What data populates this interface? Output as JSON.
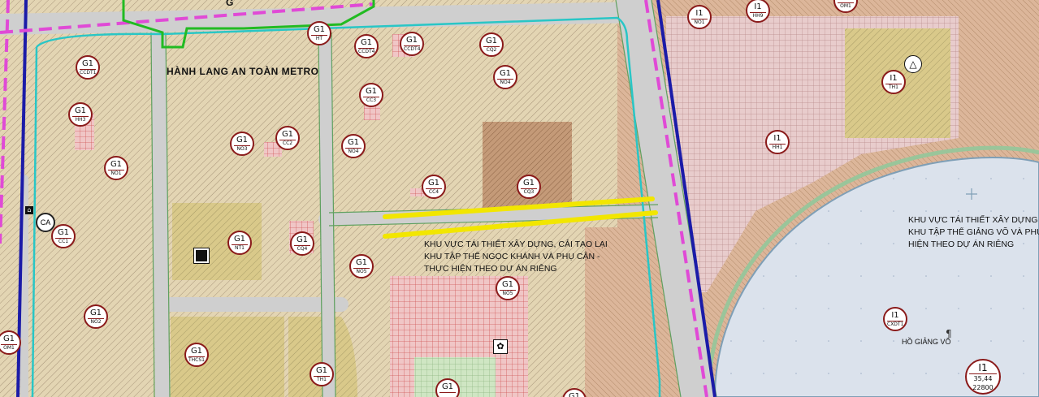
{
  "labels": {
    "metro_corridor": "HÀNH LANG AN TOÀN METRO",
    "notice_ngoc_khanh": [
      "KHU VỰC TÁI THIẾT XÂY DỰNG, CẢI TẠO LẠI",
      "KHU TẬP THỂ  NGỌC KHÁNH VÀ PHỤ CẬN -",
      "THỰC HIỆN THEO DỰ ÁN RIÊNG"
    ],
    "notice_giang_vo": [
      "KHU VỰC TÁI THIẾT XÂY DỰNG",
      "KHU TẬP THỂ GIẢNG VÕ VÀ PHỤ",
      "HIỆN THEO DỰ ÁN RIÊNG"
    ],
    "lake": "HỒ GIẢNG VÕ",
    "ca": "CA",
    "top_fragment": "G"
  },
  "markers": [
    {
      "code": "G1",
      "sub": "HT"
    },
    {
      "code": "G1",
      "sub": "CCDT4"
    },
    {
      "code": "G1",
      "sub": "CCDT4"
    },
    {
      "code": "G1",
      "sub": "CQ2"
    },
    {
      "code": "G1",
      "sub": "CCDT1"
    },
    {
      "code": "G1",
      "sub": "HH3"
    },
    {
      "code": "G1",
      "sub": "CC3"
    },
    {
      "code": "G1",
      "sub": "NO4"
    },
    {
      "code": "G1",
      "sub": "NO3"
    },
    {
      "code": "G1",
      "sub": "CC2"
    },
    {
      "code": "G1",
      "sub": "NO4"
    },
    {
      "code": "G1",
      "sub": "NO1"
    },
    {
      "code": "G1",
      "sub": "CC4"
    },
    {
      "code": "G1",
      "sub": "CQ3"
    },
    {
      "code": "G1",
      "sub": "CC1"
    },
    {
      "code": "G1",
      "sub": "NT1"
    },
    {
      "code": "G1",
      "sub": "CQ4"
    },
    {
      "code": "G1",
      "sub": "NO5"
    },
    {
      "code": "G1",
      "sub": "NO5"
    },
    {
      "code": "G1",
      "sub": "NO2"
    },
    {
      "code": "G1",
      "sub": "OM1"
    },
    {
      "code": "G1",
      "sub": "THCS1"
    },
    {
      "code": "G1",
      "sub": "TH1"
    },
    {
      "code": "G1",
      "sub": ""
    },
    {
      "code": "G1",
      "sub": ""
    },
    {
      "code": "I1",
      "sub": "NO1"
    },
    {
      "code": "I1",
      "sub": "HH9"
    },
    {
      "code": "I1",
      "sub": "OM1"
    },
    {
      "code": "I1",
      "sub": "TH1"
    },
    {
      "code": "I1",
      "sub": "HH1"
    },
    {
      "code": "I1",
      "sub": "CXDT1"
    },
    {
      "code": "I1",
      "sub": "35,44 22800"
    }
  ],
  "colors": {
    "residential": "#e3d5b3",
    "school": "#d9c98a",
    "mixed_use_pink": "#e8cccc",
    "office_brown": "#c49a78",
    "road": "#c9c9c9",
    "lake": "#d8e0ea",
    "metro_line": "#e04ad6",
    "boundary_blue": "#1b1ba8",
    "highlight": "#f2e600"
  }
}
